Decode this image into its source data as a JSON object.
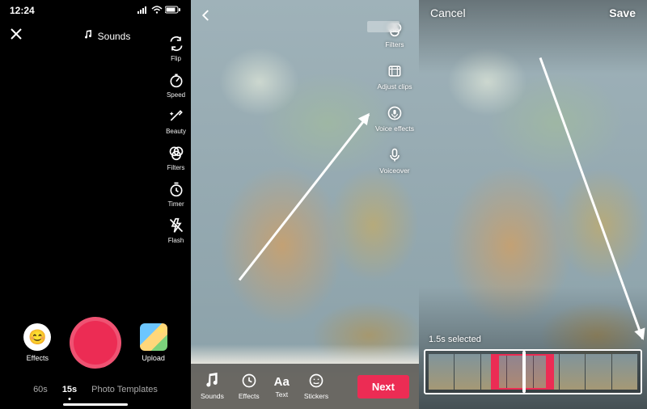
{
  "status": {
    "time": "12:24"
  },
  "panel1": {
    "sounds_label": "Sounds",
    "tools": {
      "flip": "Flip",
      "speed": "Speed",
      "beauty": "Beauty",
      "filters": "Filters",
      "timer": "Timer",
      "flash": "Flash"
    },
    "effects_label": "Effects",
    "upload_label": "Upload",
    "modes": {
      "m60s": "60s",
      "m15s": "15s",
      "photo_templates": "Photo Templates"
    }
  },
  "panel2": {
    "tools": {
      "filters": "Filters",
      "adjust_clips": "Adjust clips",
      "voice_effects": "Voice effects",
      "voiceover": "Voiceover"
    },
    "bottom": {
      "sounds": "Sounds",
      "effects": "Effects",
      "text": "Text",
      "stickers": "Stickers",
      "text_glyph": "Aa"
    },
    "next_label": "Next"
  },
  "panel3": {
    "cancel": "Cancel",
    "save": "Save",
    "selected_label": "1.5s selected"
  },
  "colors": {
    "accent": "#ec2c54"
  }
}
